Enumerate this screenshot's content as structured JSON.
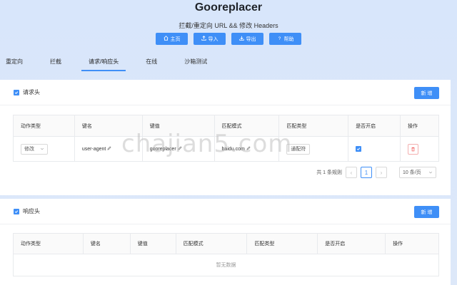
{
  "app": {
    "title": "Gooreplacer",
    "subtitle": "拦截/重定向 URL && 修改 Headers"
  },
  "toolbar": [
    {
      "label": "主页",
      "icon": "home-icon"
    },
    {
      "label": "导入",
      "icon": "upload-icon"
    },
    {
      "label": "导出",
      "icon": "download-icon"
    },
    {
      "label": "帮助",
      "icon": "help-icon"
    }
  ],
  "tabs": [
    {
      "label": "重定向"
    },
    {
      "label": "拦截"
    },
    {
      "label": "请求/响应头",
      "active": true
    },
    {
      "label": "在线"
    },
    {
      "label": "沙箱测试"
    }
  ],
  "request": {
    "title": "请求头",
    "checked": true,
    "new_label": "新 增",
    "columns": [
      "动作类型",
      "键名",
      "键值",
      "匹配模式",
      "匹配类型",
      "是否开启",
      "操作"
    ],
    "rows": [
      {
        "action": "修改",
        "key": "user-agent",
        "value": "gooreplacer",
        "pattern": "baidu.com",
        "match_type": "通配符",
        "enabled": true
      }
    ],
    "pagination": {
      "total_text": "共 1 条规则",
      "current_page": "1",
      "page_size": "10 条/页",
      "prev": "‹",
      "next": "›"
    }
  },
  "response": {
    "title": "响应头",
    "checked": true,
    "new_label": "新 增",
    "columns": [
      "动作类型",
      "键名",
      "键值",
      "匹配模式",
      "匹配类型",
      "是否开启",
      "操作"
    ],
    "empty_text": "暂无数据"
  },
  "watermark": "chajian5.com",
  "colors": {
    "accent": "#3f8ff7",
    "background": "#d8e6fb",
    "danger": "#f05050"
  }
}
